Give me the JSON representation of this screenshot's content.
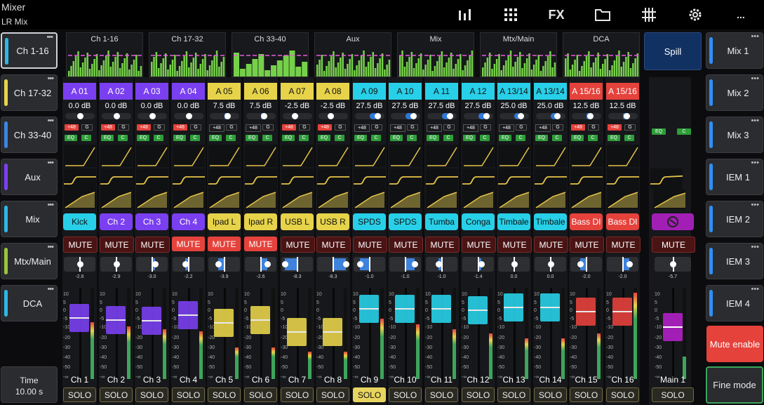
{
  "app": {
    "title": "Mixer",
    "subtitle": "LR Mix"
  },
  "toolbar": {
    "icons": [
      "meters-icon",
      "grid-icon",
      "fx-icon",
      "folder-icon",
      "routing-icon",
      "settings-icon",
      "more-icon"
    ],
    "fx_label": "FX",
    "more_label": "..."
  },
  "left_nav": [
    {
      "label": "Ch 1-16",
      "color": "#2fb7e6",
      "active": true,
      "dots": "•••"
    },
    {
      "label": "Ch 17-32",
      "color": "#e6d34a",
      "active": false,
      "dots": "•••"
    },
    {
      "label": "Ch 33-40",
      "color": "#3c86e0",
      "active": false,
      "dots": "•••"
    },
    {
      "label": "Aux",
      "color": "#7b3ff2",
      "active": false,
      "dots": "•••"
    },
    {
      "label": "Mix",
      "color": "#2fb7e6",
      "active": false,
      "dots": "•••"
    },
    {
      "label": "Mtx/Main",
      "color": "#9ac43b",
      "active": false,
      "dots": "•••"
    },
    {
      "label": "DCA",
      "color": "#2fb7e6",
      "active": false,
      "dots": "•••"
    }
  ],
  "time": {
    "label": "Time",
    "value": "10.00 s"
  },
  "overview_blocks": [
    "Ch 1-16",
    "Ch 17-32",
    "Ch 33-40",
    "Aux",
    "Mix",
    "Mtx/Main",
    "DCA"
  ],
  "spill": "Spill",
  "right_nav": [
    {
      "label": "Mix 1",
      "dots": "•••"
    },
    {
      "label": "Mix 2",
      "dots": "•••"
    },
    {
      "label": "Mix 3",
      "dots": "•••"
    },
    {
      "label": "IEM 1",
      "dots": "•••"
    },
    {
      "label": "IEM 2",
      "dots": "•••"
    },
    {
      "label": "IEM 3",
      "dots": "•••"
    },
    {
      "label": "IEM 4",
      "dots": "•••"
    }
  ],
  "mute_enable": "Mute enable",
  "fine_mode": "Fine mode",
  "tags": {
    "phantom": "+48",
    "gate": "G",
    "eq": "EQ",
    "comp": "C"
  },
  "mute_label": "MUTE",
  "solo_label": "SOLO",
  "fader_scale": [
    "10",
    "5",
    "0",
    "-5",
    "-10",
    "-20",
    "-30",
    "-40",
    "-50",
    "-∞"
  ],
  "channels": [
    {
      "source": "A 01",
      "gain": "0.0 dB",
      "trim": 0.5,
      "name": "Kick",
      "label": "Ch 1",
      "color": "#7a3ff0",
      "namecolor": "#27d0e8",
      "muted": false,
      "solo": false,
      "pan": 0.5,
      "panval": "-2.6",
      "fader": 0.25,
      "meter": 0.62,
      "phantom": true
    },
    {
      "source": "A 02",
      "gain": "0.0 dB",
      "trim": 0.5,
      "name": "Ch 2",
      "label": "Ch 2",
      "color": "#7a3ff0",
      "namecolor": "#7a3ff0",
      "muted": false,
      "solo": false,
      "pan": 0.5,
      "panval": "-2.9",
      "fader": 0.27,
      "meter": 0.58,
      "phantom": true
    },
    {
      "source": "A 03",
      "gain": "0.0 dB",
      "trim": 0.5,
      "name": "Ch 3",
      "label": "Ch 3",
      "color": "#7a3ff0",
      "namecolor": "#7a3ff0",
      "muted": false,
      "solo": false,
      "pan": 0.6,
      "panval": "-3.0",
      "fader": 0.28,
      "meter": 0.55,
      "phantom": true
    },
    {
      "source": "A 04",
      "gain": "0.0 dB",
      "trim": 0.5,
      "name": "Ch 4",
      "label": "Ch 4",
      "color": "#7a3ff0",
      "namecolor": "#7a3ff0",
      "muted": true,
      "solo": false,
      "pan": 0.4,
      "panval": "-2.2",
      "fader": 0.22,
      "meter": 0.52,
      "phantom": true
    },
    {
      "source": "A 05",
      "gain": "7.5 dB",
      "trim": 0.6,
      "name": "Ipad L",
      "label": "Ch 5",
      "color": "#e6d34a",
      "namecolor": "#e6d34a",
      "muted": true,
      "solo": false,
      "pan": 0.3,
      "panval": "-3.9",
      "fader": 0.3,
      "meter": 0.35,
      "phantom": false
    },
    {
      "source": "A 06",
      "gain": "7.5 dB",
      "trim": 0.6,
      "name": "Ipad R",
      "label": "Ch 6",
      "color": "#e6d34a",
      "namecolor": "#e6d34a",
      "muted": true,
      "solo": false,
      "pan": 0.7,
      "panval": "-2.6",
      "fader": 0.27,
      "meter": 0.35,
      "phantom": false
    },
    {
      "source": "A 07",
      "gain": "-2.5 dB",
      "trim": 0.4,
      "name": "USB L",
      "label": "Ch 7",
      "color": "#e6d34a",
      "namecolor": "#e6d34a",
      "muted": false,
      "solo": false,
      "pan": 0.1,
      "panval": "-8.3",
      "fader": 0.4,
      "meter": 0.3,
      "phantom": true
    },
    {
      "source": "A 08",
      "gain": "-2.5 dB",
      "trim": 0.4,
      "name": "USB R",
      "label": "Ch 8",
      "color": "#e6d34a",
      "namecolor": "#e6d34a",
      "muted": false,
      "solo": false,
      "pan": 0.9,
      "panval": "-8.3",
      "fader": 0.4,
      "meter": 0.3,
      "phantom": true
    },
    {
      "source": "A 09",
      "gain": "27.5 dB",
      "trim": 0.75,
      "name": "SPDS",
      "label": "Ch 9",
      "color": "#27d0e8",
      "namecolor": "#27d0e8",
      "muted": false,
      "solo": true,
      "pan": 0.2,
      "panval": "-1.0",
      "fader": 0.15,
      "meter": 0.66,
      "phantom": false
    },
    {
      "source": "A 10",
      "gain": "27.5 dB",
      "trim": 0.75,
      "name": "SPDS",
      "label": "Ch 10",
      "color": "#27d0e8",
      "namecolor": "#27d0e8",
      "muted": false,
      "solo": false,
      "pan": 0.8,
      "panval": "-1.0",
      "fader": 0.15,
      "meter": 0.6,
      "phantom": false
    },
    {
      "source": "A 11",
      "gain": "27.5 dB",
      "trim": 0.75,
      "name": "Tumba",
      "label": "Ch 11",
      "color": "#27d0e8",
      "namecolor": "#27d0e8",
      "muted": false,
      "solo": false,
      "pan": 0.4,
      "panval": "-1.0",
      "fader": 0.15,
      "meter": 0.55,
      "phantom": false
    },
    {
      "source": "A 12",
      "gain": "27.5 dB",
      "trim": 0.75,
      "name": "Conga",
      "label": "Ch 12",
      "color": "#27d0e8",
      "namecolor": "#27d0e8",
      "muted": false,
      "solo": false,
      "pan": 0.6,
      "panval": "-1.4",
      "fader": 0.17,
      "meter": 0.5,
      "phantom": false
    },
    {
      "source": "A 13/14",
      "gain": "25.0 dB",
      "trim": 0.72,
      "name": "Timbale",
      "label": "Ch 13",
      "color": "#27d0e8",
      "namecolor": "#27d0e8",
      "muted": false,
      "solo": false,
      "pan": 0.5,
      "panval": "0.0",
      "fader": 0.14,
      "meter": 0.45,
      "phantom": false
    },
    {
      "source": "A 13/14",
      "gain": "25.0 dB",
      "trim": 0.72,
      "name": "Timbale",
      "label": "Ch 14",
      "color": "#27d0e8",
      "namecolor": "#27d0e8",
      "muted": false,
      "solo": false,
      "pan": 0.5,
      "panval": "0.0",
      "fader": 0.14,
      "meter": 0.45,
      "phantom": false
    },
    {
      "source": "A 15/16",
      "gain": "12.5 dB",
      "trim": 0.62,
      "name": "Bass DI",
      "label": "Ch 15",
      "color": "#e5423c",
      "namecolor": "#e5423c",
      "muted": false,
      "solo": false,
      "pan": 0.3,
      "panval": "-2.0",
      "fader": 0.18,
      "meter": 0.5,
      "phantom": true
    },
    {
      "source": "A 15/16",
      "gain": "12.5 dB",
      "trim": 0.62,
      "name": "Bass DI",
      "label": "Ch 16",
      "color": "#e5423c",
      "namecolor": "#e5423c",
      "muted": false,
      "solo": false,
      "pan": 0.7,
      "panval": "-2.0",
      "fader": 0.18,
      "meter": 0.95,
      "phantom": true
    }
  ],
  "main": {
    "label": "Main 1",
    "panval": "-5.7",
    "fader": 0.35,
    "color": "#a21fb5",
    "meter": 0.25
  }
}
